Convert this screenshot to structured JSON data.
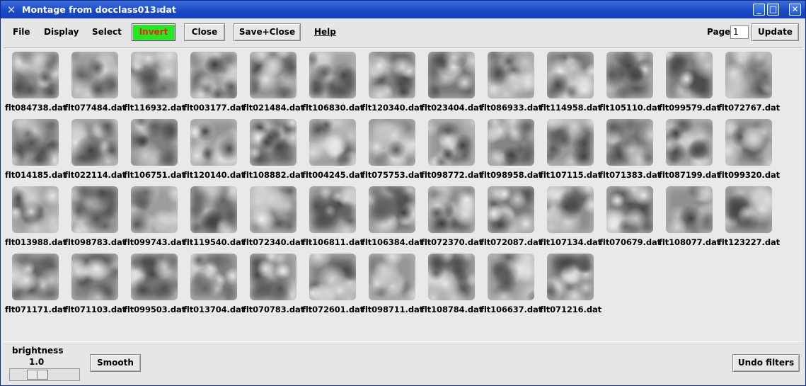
{
  "window": {
    "title": "Montage from docclass013.dat",
    "app_icon": "x-close-icon",
    "swirl_icon": "swirl-icon",
    "controls": [
      "minimize",
      "maximize",
      "close"
    ]
  },
  "menu": {
    "file": "File",
    "display": "Display",
    "select": "Select",
    "help": "Help"
  },
  "buttons": {
    "invert": "Invert",
    "close": "Close",
    "save_close": "Save+Close",
    "update": "Update",
    "smooth": "Smooth",
    "undo_filters": "Undo filters"
  },
  "colors": {
    "invert_bg": "#21ea21",
    "invert_text": "#ff1a1a",
    "titlebar": "#1c4bc8"
  },
  "page": {
    "label": "Page",
    "value": "1"
  },
  "brightness": {
    "label": "brightness",
    "value": "1.0"
  },
  "images": [
    "flt084738.dat",
    "flt077484.dat",
    "flt116932.dat",
    "flt003177.dat",
    "flt021484.dat",
    "flt106830.dat",
    "flt120340.dat",
    "flt023404.dat",
    "flt086933.dat",
    "flt114958.dat",
    "flt105110.dat",
    "flt099579.dat",
    "flt072767.dat",
    "flt014185.dat",
    "flt022114.dat",
    "flt106751.dat",
    "flt120140.dat",
    "flt108882.dat",
    "flt004245.dat",
    "flt075753.dat",
    "flt098772.dat",
    "flt098958.dat",
    "flt107115.dat",
    "flt071383.dat",
    "flt087199.dat",
    "flt099320.dat",
    "flt013988.dat",
    "flt098783.dat",
    "flt099743.dat",
    "flt119540.dat",
    "flt072340.dat",
    "flt106811.dat",
    "flt106384.dat",
    "flt072370.dat",
    "flt072087.dat",
    "flt107134.dat",
    "flt070679.dat",
    "flt108077.dat",
    "flt123227.dat",
    "flt071171.dat",
    "flt071103.dat",
    "flt099503.dat",
    "flt013704.dat",
    "flt070783.dat",
    "flt072601.dat",
    "flt098711.dat",
    "flt108784.dat",
    "flt106637.dat",
    "flt071216.dat"
  ]
}
